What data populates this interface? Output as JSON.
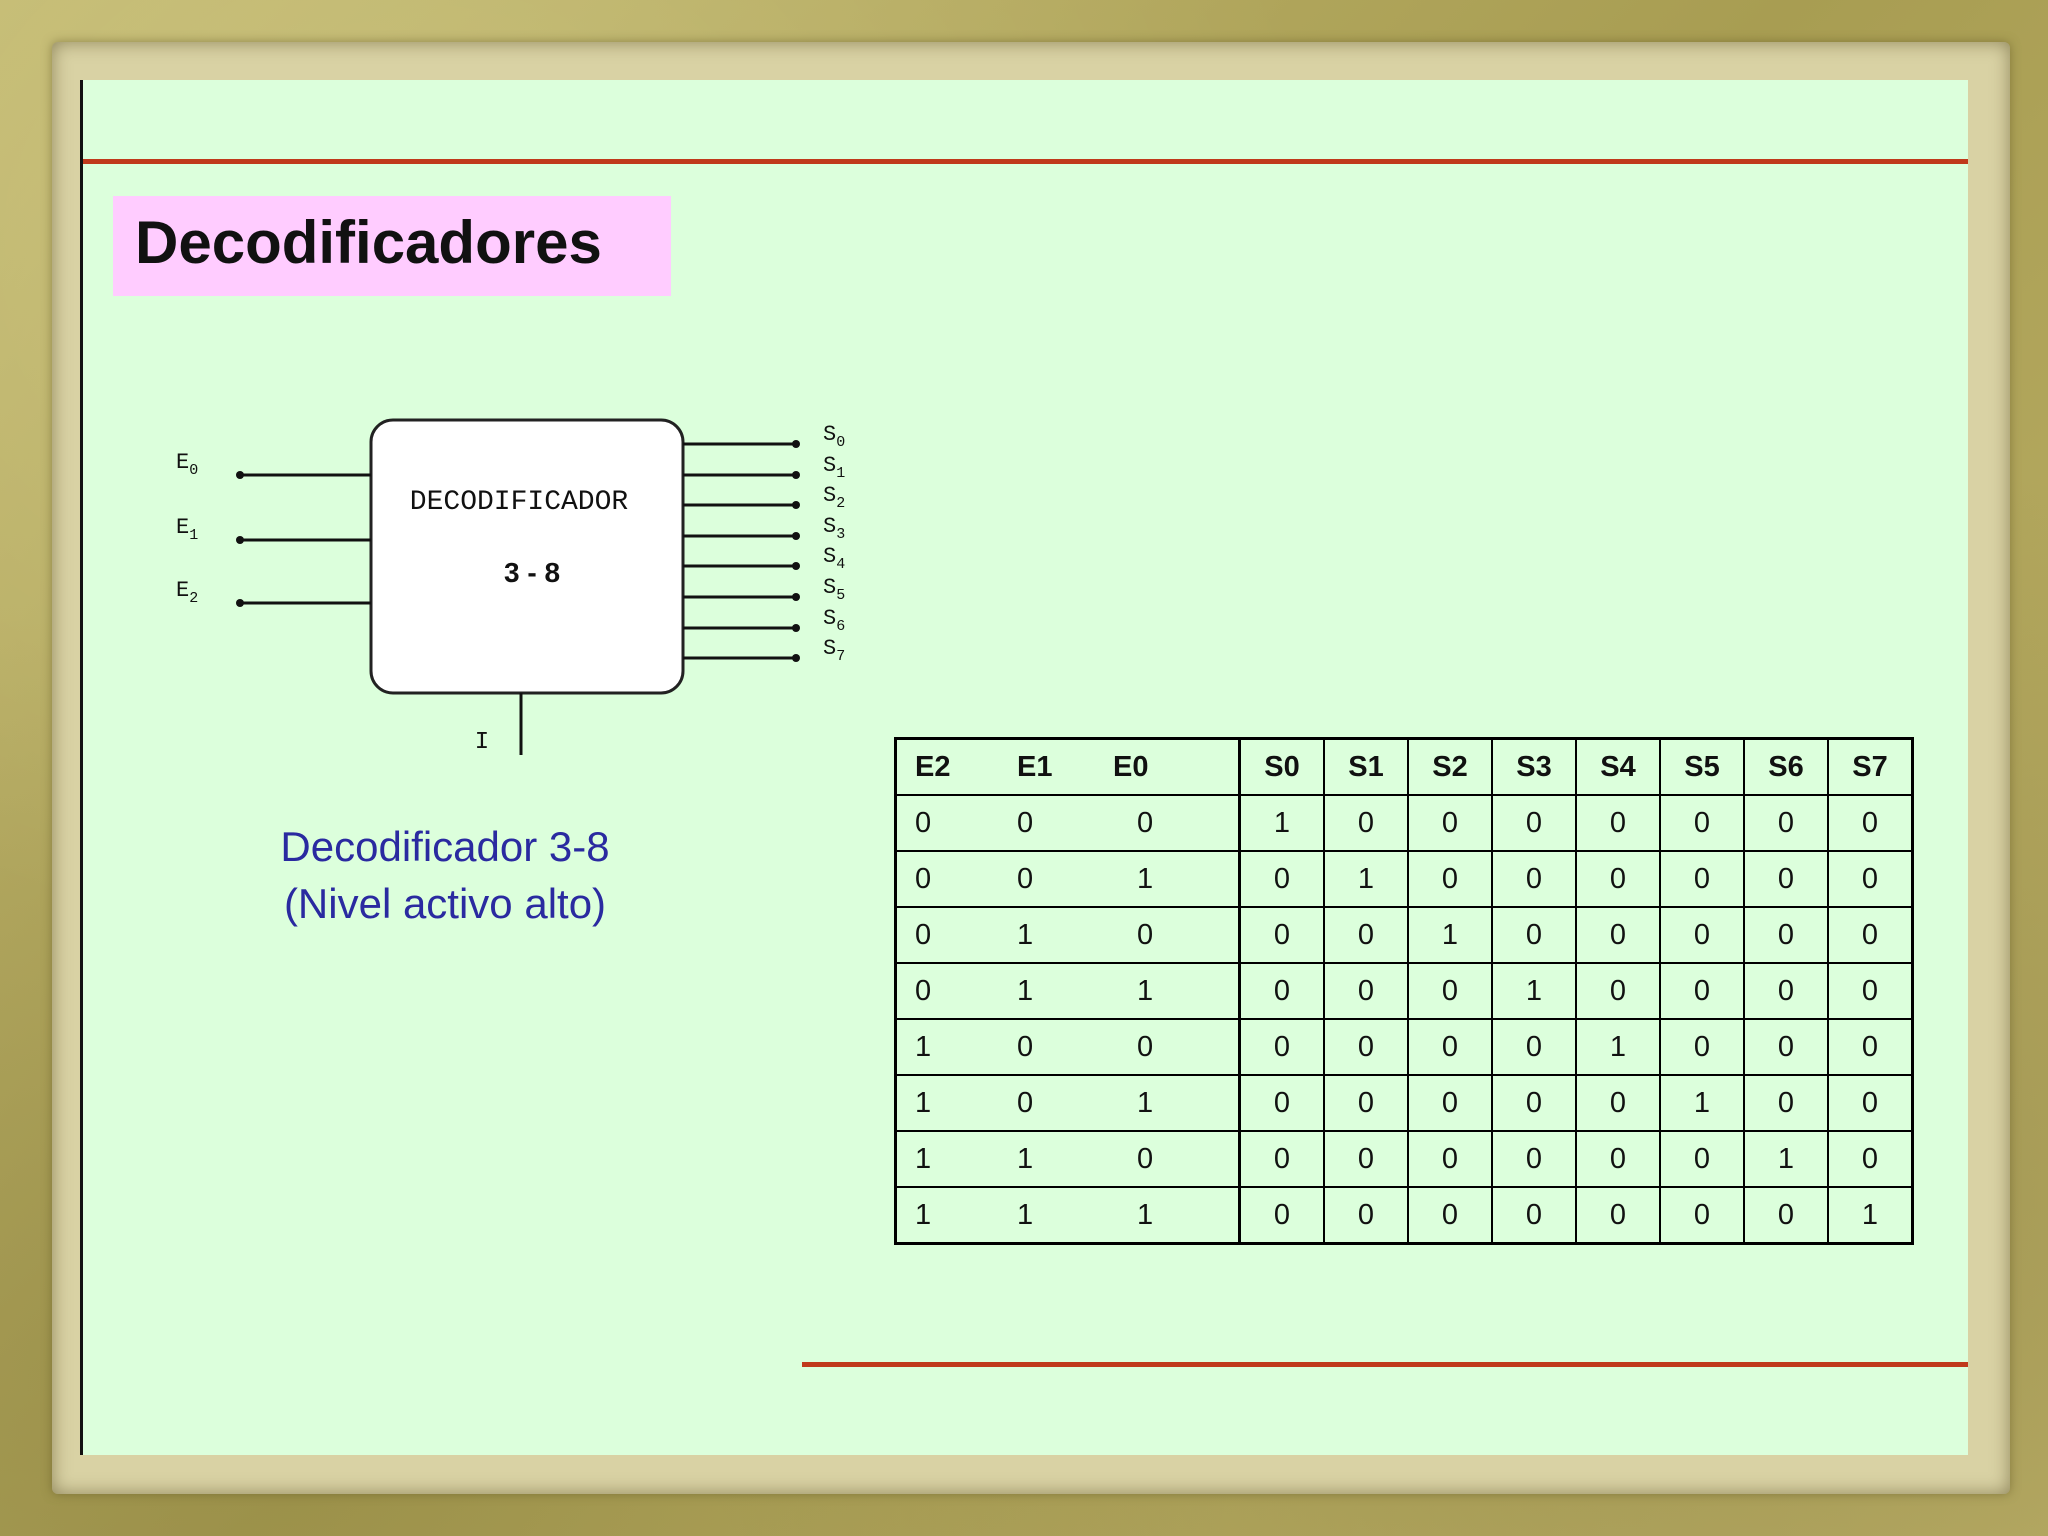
{
  "slide": {
    "title": "Decodificadores",
    "caption_line1": "Decodificador 3-8",
    "caption_line2": "(Nivel activo alto)",
    "accent_color": "#c0391b",
    "title_bg_color": "#ffccff",
    "slide_bg_color": "#dcffdc"
  },
  "diagram": {
    "block_label": "DECODIFICADOR",
    "block_subtitle": "3 - 8",
    "enable_label": "I",
    "inputs": [
      {
        "base": "E",
        "sub": "0"
      },
      {
        "base": "E",
        "sub": "1"
      },
      {
        "base": "E",
        "sub": "2"
      }
    ],
    "outputs": [
      {
        "base": "S",
        "sub": "0"
      },
      {
        "base": "S",
        "sub": "1"
      },
      {
        "base": "S",
        "sub": "2"
      },
      {
        "base": "S",
        "sub": "3"
      },
      {
        "base": "S",
        "sub": "4"
      },
      {
        "base": "S",
        "sub": "5"
      },
      {
        "base": "S",
        "sub": "6"
      },
      {
        "base": "S",
        "sub": "7"
      }
    ]
  },
  "table": {
    "headers": [
      "E2",
      "E1",
      "E0",
      "S0",
      "S1",
      "S2",
      "S3",
      "S4",
      "S5",
      "S6",
      "S7"
    ],
    "rows": [
      [
        "0",
        "0",
        "0",
        "1",
        "0",
        "0",
        "0",
        "0",
        "0",
        "0",
        "0"
      ],
      [
        "0",
        "0",
        "1",
        "0",
        "1",
        "0",
        "0",
        "0",
        "0",
        "0",
        "0"
      ],
      [
        "0",
        "1",
        "0",
        "0",
        "0",
        "1",
        "0",
        "0",
        "0",
        "0",
        "0"
      ],
      [
        "0",
        "1",
        "1",
        "0",
        "0",
        "0",
        "1",
        "0",
        "0",
        "0",
        "0"
      ],
      [
        "1",
        "0",
        "0",
        "0",
        "0",
        "0",
        "0",
        "1",
        "0",
        "0",
        "0"
      ],
      [
        "1",
        "0",
        "1",
        "0",
        "0",
        "0",
        "0",
        "0",
        "1",
        "0",
        "0"
      ],
      [
        "1",
        "1",
        "0",
        "0",
        "0",
        "0",
        "0",
        "0",
        "0",
        "1",
        "0"
      ],
      [
        "1",
        "1",
        "1",
        "0",
        "0",
        "0",
        "0",
        "0",
        "0",
        "0",
        "1"
      ]
    ]
  }
}
